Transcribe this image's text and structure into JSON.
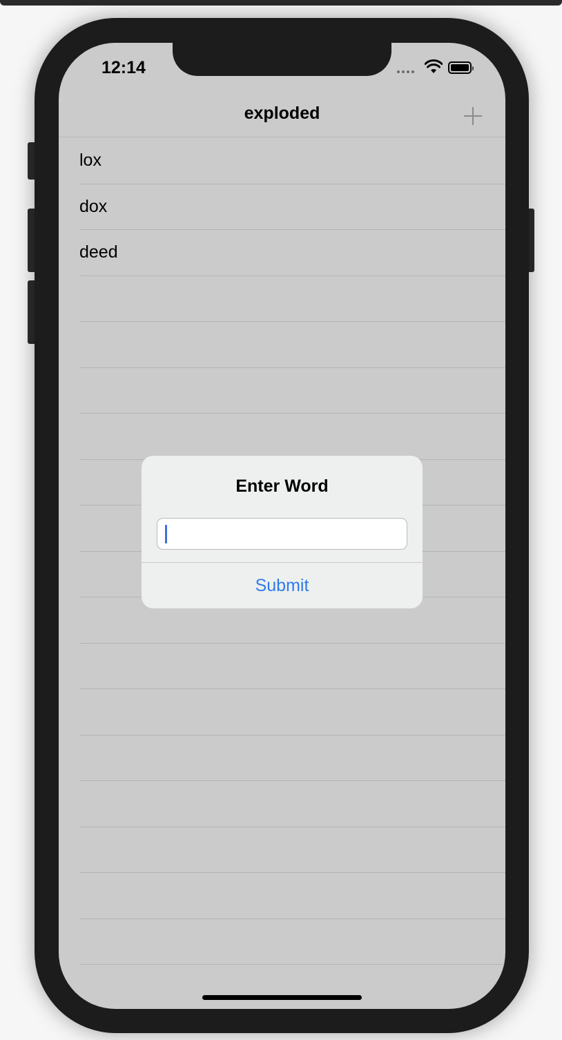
{
  "status_bar": {
    "time": "12:14"
  },
  "nav": {
    "title": "exploded"
  },
  "list": {
    "items": [
      "lox",
      "dox",
      "deed",
      "",
      "",
      "",
      "",
      "",
      "",
      "",
      "",
      "",
      "",
      "",
      "",
      "",
      "",
      "",
      ""
    ]
  },
  "alert": {
    "title": "Enter Word",
    "input_value": "",
    "submit_label": "Submit"
  },
  "colors": {
    "accent": "#2f7be8",
    "background": "#cbcbcb",
    "alert_bg": "#eef0f0"
  }
}
